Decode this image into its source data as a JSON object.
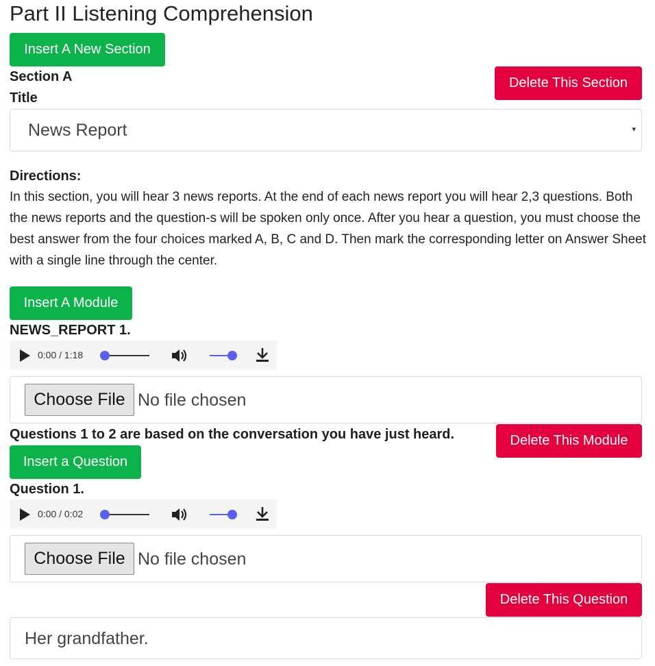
{
  "page": {
    "title": "Part II Listening Comprehension",
    "insert_section_label": "Insert A New Section"
  },
  "section": {
    "name": "Section A",
    "delete_label": "Delete This Section",
    "title_label": "Title",
    "title_value": "News Report",
    "directions_label": "Directions:",
    "directions_text": "In this section, you will hear 3 news reports. At the end of each news report you will hear 2,3 questions. Both the news reports and the question-s will be spoken only once. After you hear a question, you must choose the best answer from the four choices marked A, B, C and D. Then mark the corresponding letter on Answer Sheet with a single line through the center.",
    "insert_module_label": "Insert A Module"
  },
  "module": {
    "name": "NEWS_REPORT 1.",
    "audio_time": "0:00 / 1:18",
    "file_button": "Choose File",
    "file_status": "No file chosen",
    "questions_note": "Questions 1 to 2 are based on the conversation you have just heard.",
    "delete_label": "Delete This Module",
    "insert_question_label": "Insert a Question"
  },
  "question": {
    "name": "Question 1.",
    "audio_time": "0:00 / 0:02",
    "file_button": "Choose File",
    "file_status": "No file chosen",
    "delete_label": "Delete This Question",
    "answer_value": "Her grandfather."
  },
  "colors": {
    "green": "#0bb34a",
    "red": "#e4003f",
    "audio_accent": "#5b5ff0"
  }
}
